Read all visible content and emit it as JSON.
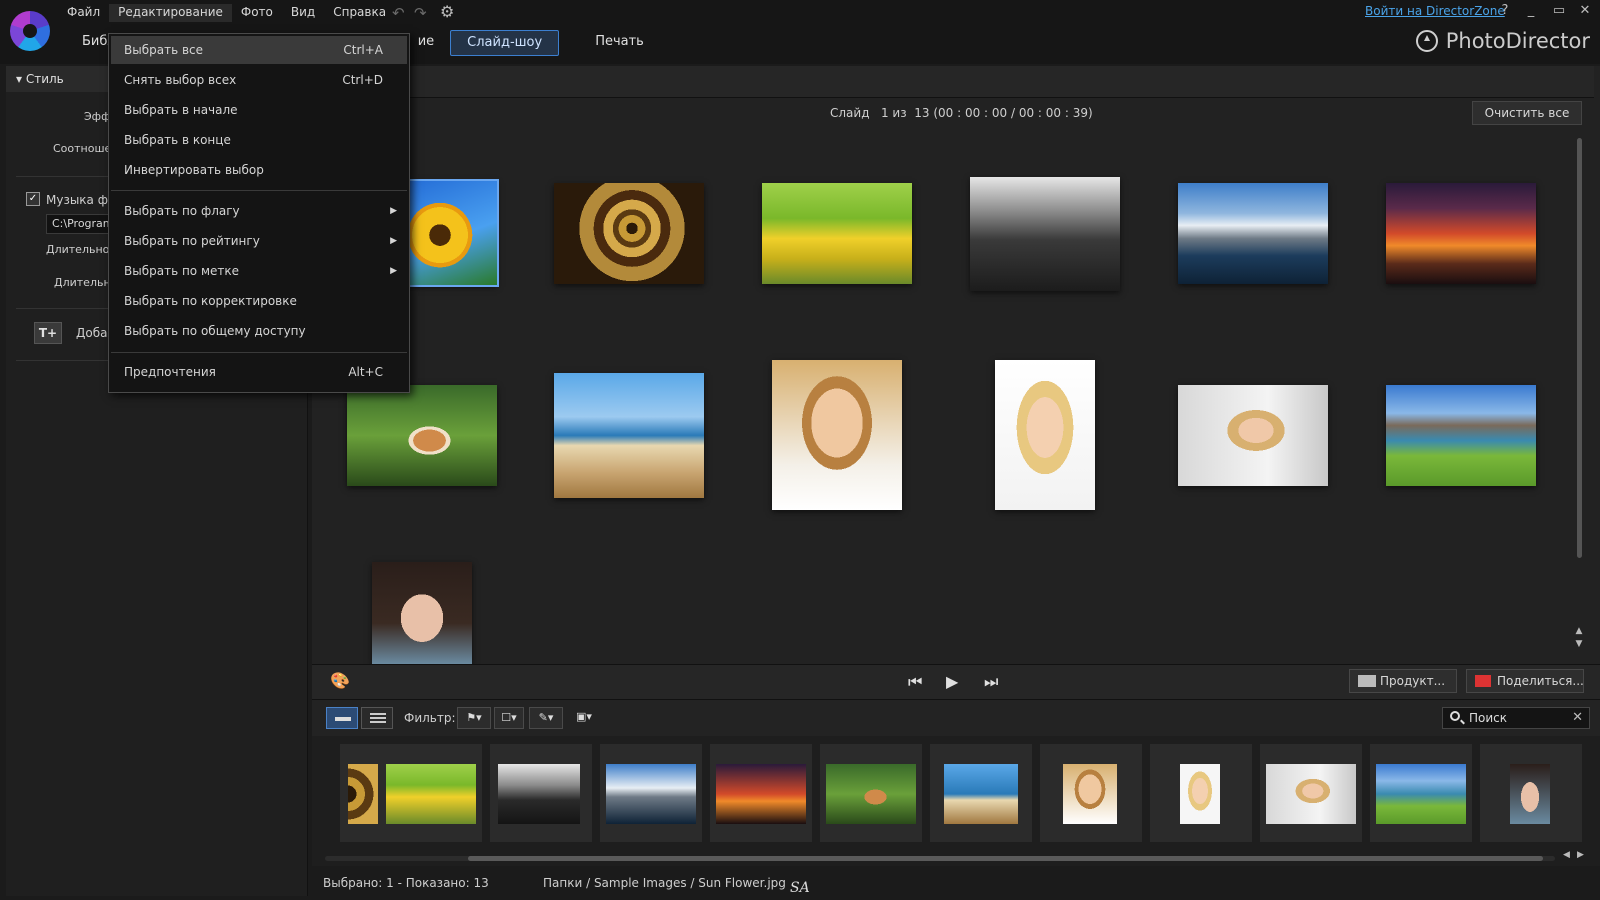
{
  "menubar": {
    "items": [
      {
        "label": "Файл"
      },
      {
        "label": "Редактирование"
      },
      {
        "label": "Фото"
      },
      {
        "label": "Вид"
      },
      {
        "label": "Справка"
      }
    ]
  },
  "topright": {
    "login_link": "Войти на DirectorZone",
    "help": "?",
    "minimize": "_",
    "restore": "▭",
    "close": "✕"
  },
  "tabs": {
    "library": "Библ",
    "edit_tail": "ие",
    "slideshow": "Слайд-шоу",
    "print": "Печать"
  },
  "brand": {
    "name": "PhotoDirector"
  },
  "leftpanel": {
    "section_title": "Стиль",
    "effect_label": "Эфф",
    "ratio_label": "Соотноше",
    "music_label": "Музыка ф",
    "music_path": "C:\\Program",
    "duration1_label": "Длительнос",
    "duration2_label": "Длительно",
    "add_text_label": "Доба",
    "add_text_icon": "T+"
  },
  "main": {
    "slide_label": "Слайд",
    "slide_position": "1 из",
    "slide_count": "13 (00 : 00 : 00 / 00 : 00 : 39)",
    "clear_all": "Очистить все"
  },
  "playbar": {
    "produce": "Продукт...",
    "share": "Поделиться..."
  },
  "filterbar": {
    "filter_label": "Фильтр:",
    "search_placeholder": "Поиск"
  },
  "status": {
    "selection": "Выбрано: 1 - Показано: 13",
    "path": "Папки / Sample Images / Sun Flower.jpg",
    "watermark": "SA"
  },
  "dropdown": {
    "items": [
      {
        "label": "Выбрать все",
        "shortcut": "Ctrl+A"
      },
      {
        "label": "Снять выбор всех",
        "shortcut": "Ctrl+D"
      },
      {
        "label": "Выбрать в начале",
        "shortcut": ""
      },
      {
        "label": "Выбрать в конце",
        "shortcut": ""
      },
      {
        "label": "Инвертировать выбор",
        "shortcut": ""
      },
      {
        "label": "Выбрать по флагу",
        "shortcut": ""
      },
      {
        "label": "Выбрать по рейтингу",
        "shortcut": ""
      },
      {
        "label": "Выбрать по метке",
        "shortcut": ""
      },
      {
        "label": "Выбрать по корректировке",
        "shortcut": ""
      },
      {
        "label": "Выбрать по общему доступу",
        "shortcut": ""
      },
      {
        "label": "Предпочтения",
        "shortcut": "Alt+C"
      }
    ]
  },
  "colors": {
    "accent": "#3c7fd0",
    "link": "#4aa3e8"
  }
}
